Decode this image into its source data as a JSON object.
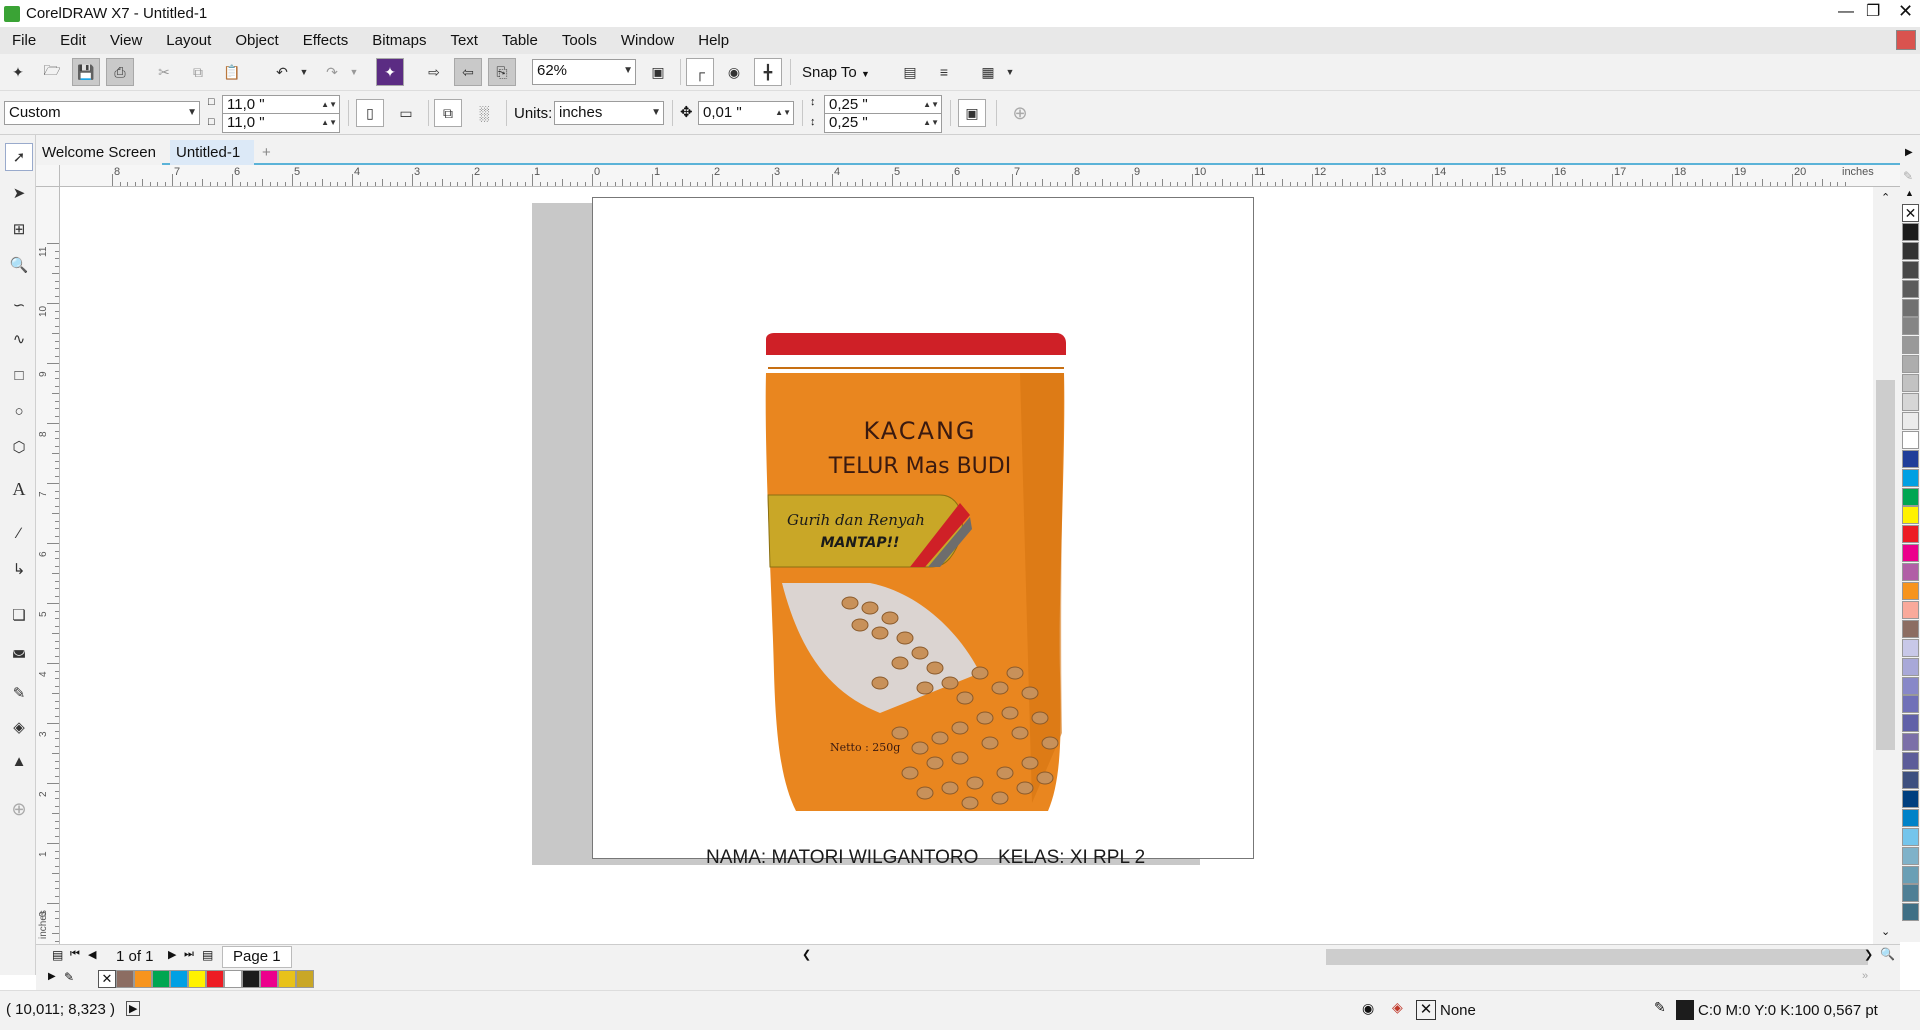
{
  "app": {
    "title": "CorelDRAW X7 - Untitled-1"
  },
  "menu": [
    "File",
    "Edit",
    "View",
    "Layout",
    "Object",
    "Effects",
    "Bitmaps",
    "Text",
    "Table",
    "Tools",
    "Window",
    "Help"
  ],
  "toolbar": {
    "zoom_value": "62%",
    "snap_to_label": "Snap To"
  },
  "property_bar": {
    "page_preset": "Custom",
    "page_width": "11,0 \"",
    "page_height": "11,0 \"",
    "units_label": "Units:",
    "units_value": "inches",
    "nudge_value": "0,01 \"",
    "dup_x": "0,25 \"",
    "dup_y": "0,25 \""
  },
  "tabs": [
    "Welcome Screen",
    "Untitled-1"
  ],
  "ruler": {
    "h_labels": [
      "8",
      "7",
      "6",
      "5",
      "4",
      "3",
      "2",
      "1",
      "0",
      "1",
      "2",
      "3",
      "4",
      "5",
      "6",
      "7",
      "8",
      "9",
      "10",
      "11",
      "12",
      "13",
      "14",
      "15",
      "16",
      "17",
      "18",
      "19",
      "20"
    ],
    "h_unit": "inches",
    "v_labels": [
      "11",
      "10",
      "9",
      "8",
      "7",
      "6",
      "5",
      "4",
      "3",
      "2",
      "1",
      "0"
    ],
    "v_unit": "inches"
  },
  "artwork": {
    "title_line1": "KACANG",
    "title_line2": "TELUR Mas BUDI",
    "tag_line1": "Gurih dan Renyah",
    "tag_line2": "MANTAP!!",
    "netto": "Netto : 250g",
    "caption_name": "NAMA: MATORI WILGANTORO",
    "caption_class": "KELAS: XI RPL 2",
    "colors": {
      "bag": "#e9861f",
      "band": "#cf2027",
      "tag": "#c9a727"
    }
  },
  "page_nav": {
    "counter": "1 of 1",
    "page_tab": "Page 1"
  },
  "status": {
    "coords": "( 10,011; 8,323 )",
    "fill": "None",
    "outline": "C:0 M:0 Y:0 K:100  0,567 pt"
  },
  "palette": [
    "#ffffff",
    "#1c1c1c",
    "#333333",
    "#474747",
    "#5b5b5b",
    "#707070",
    "#858585",
    "#999999",
    "#adadad",
    "#c2c2c2",
    "#d6d6d6",
    "#ebebeb",
    "#ffffff",
    "#1f3d99",
    "#00a0e3",
    "#00a651",
    "#fff200",
    "#ed1c24",
    "#ec008c",
    "#b15fa6",
    "#f7941d",
    "#f9a99a",
    "#8c6d62",
    "#c8c8e8",
    "#a8a8d8",
    "#8888c8",
    "#7070b8",
    "#6060a8",
    "#7b6fa8",
    "#5c5c99",
    "#3d4f7f",
    "#003f7f",
    "#0082c8",
    "#74c5ec",
    "#7fb2c9",
    "#6a9fb5",
    "#4f7f95",
    "#3f6f85"
  ],
  "doc_palette": [
    "#8c6d62",
    "#f7941d",
    "#00a651",
    "#00a0e3",
    "#fff200",
    "#ed1c24",
    "#ffffff",
    "#1c1c1c",
    "#ec008c",
    "#e8c21a",
    "#c9a727"
  ]
}
